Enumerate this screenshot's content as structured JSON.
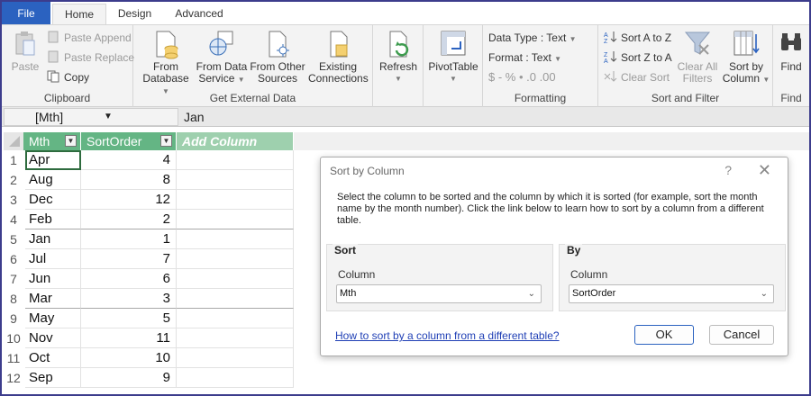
{
  "tabs": [
    "File",
    "Home",
    "Design",
    "Advanced"
  ],
  "ribbon": {
    "clipboard": {
      "label": "Clipboard",
      "paste": "Paste",
      "paste_append": "Paste Append",
      "paste_replace": "Paste Replace",
      "copy": "Copy"
    },
    "external": {
      "label": "Get External Data",
      "from_database_1": "From",
      "from_database_2": "Database",
      "from_service_1": "From Data",
      "from_service_2": "Service",
      "from_other_1": "From Other",
      "from_other_2": "Sources",
      "existing_1": "Existing",
      "existing_2": "Connections"
    },
    "refresh": "Refresh",
    "pivot": "PivotTable",
    "formatting": {
      "label": "Formatting",
      "data_type": "Data Type : Text",
      "format": "Format : Text",
      "symbols": "$ - % • .0 .00"
    },
    "sortfilter": {
      "label": "Sort and Filter",
      "sort_az": "Sort A to Z",
      "sort_za": "Sort Z to A",
      "clear_sort": "Clear Sort",
      "clear_filters_1": "Clear All",
      "clear_filters_2": "Filters",
      "sort_by_col_1": "Sort by",
      "sort_by_col_2": "Column"
    },
    "find": {
      "label": "Find",
      "button": "Find"
    }
  },
  "formula_bar": {
    "name_box": "[Mth]",
    "value": "Jan"
  },
  "grid": {
    "columns": [
      "Mth",
      "SortOrder",
      "Add Column"
    ],
    "rows": [
      {
        "n": "1",
        "mth": "Apr",
        "sort": "4"
      },
      {
        "n": "2",
        "mth": "Aug",
        "sort": "8"
      },
      {
        "n": "3",
        "mth": "Dec",
        "sort": "12"
      },
      {
        "n": "4",
        "mth": "Feb",
        "sort": "2"
      },
      {
        "n": "5",
        "mth": "Jan",
        "sort": "1"
      },
      {
        "n": "6",
        "mth": "Jul",
        "sort": "7"
      },
      {
        "n": "7",
        "mth": "Jun",
        "sort": "6"
      },
      {
        "n": "8",
        "mth": "Mar",
        "sort": "3"
      },
      {
        "n": "9",
        "mth": "May",
        "sort": "5"
      },
      {
        "n": "10",
        "mth": "Nov",
        "sort": "11"
      },
      {
        "n": "11",
        "mth": "Oct",
        "sort": "10"
      },
      {
        "n": "12",
        "mth": "Sep",
        "sort": "9"
      }
    ]
  },
  "dialog": {
    "title": "Sort by Column",
    "help": "?",
    "close": "✕",
    "description": "Select the column to be sorted and the column by which it is sorted (for example, sort the month name by the month number). Click the link below to learn how to sort by a column from a different table.",
    "sort_heading": "Sort",
    "sort_column_label": "Column",
    "sort_column_value": "Mth",
    "by_heading": "By",
    "by_column_label": "Column",
    "by_column_value": "SortOrder",
    "link": "How to sort by a column from a different table?",
    "ok": "OK",
    "cancel": "Cancel"
  },
  "colors": {
    "file_tab": "#2b62c0",
    "header_green": "#64b584",
    "add_column": "#9ed0ae",
    "link": "#1f3fb5"
  }
}
